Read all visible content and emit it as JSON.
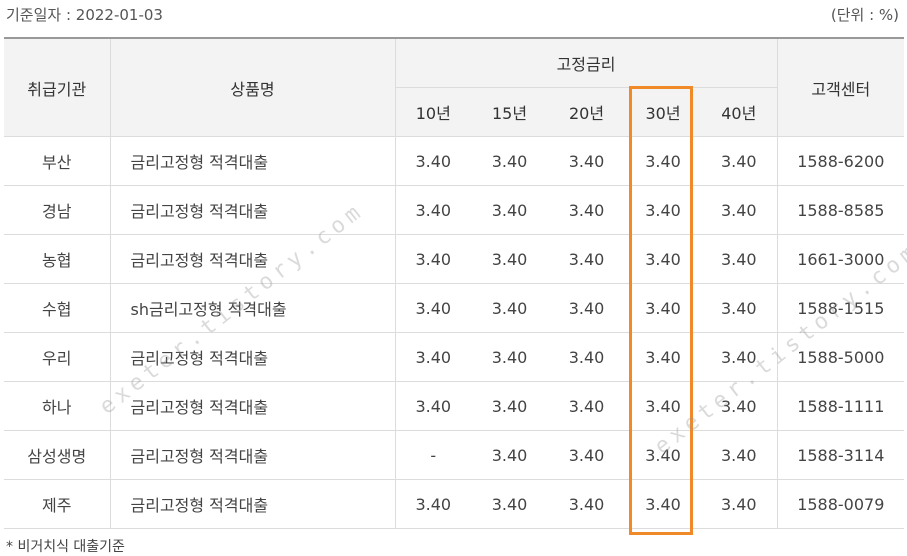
{
  "date_label": "기준일자 : 2022-01-03",
  "unit_label": "(단위 : %)",
  "headers": {
    "institution": "취급기관",
    "product": "상품명",
    "fixed_rate": "고정금리",
    "customer_center": "고객센터",
    "terms": [
      "10년",
      "15년",
      "20년",
      "30년",
      "40년"
    ]
  },
  "rows": [
    {
      "institution": "부산",
      "product": "금리고정형 적격대출",
      "rates": [
        "3.40",
        "3.40",
        "3.40",
        "3.40",
        "3.40"
      ],
      "phone": "1588-6200"
    },
    {
      "institution": "경남",
      "product": "금리고정형 적격대출",
      "rates": [
        "3.40",
        "3.40",
        "3.40",
        "3.40",
        "3.40"
      ],
      "phone": "1588-8585"
    },
    {
      "institution": "농협",
      "product": "금리고정형 적격대출",
      "rates": [
        "3.40",
        "3.40",
        "3.40",
        "3.40",
        "3.40"
      ],
      "phone": "1661-3000"
    },
    {
      "institution": "수협",
      "product": "sh금리고정형 적격대출",
      "rates": [
        "3.40",
        "3.40",
        "3.40",
        "3.40",
        "3.40"
      ],
      "phone": "1588-1515"
    },
    {
      "institution": "우리",
      "product": "금리고정형 적격대출",
      "rates": [
        "3.40",
        "3.40",
        "3.40",
        "3.40",
        "3.40"
      ],
      "phone": "1588-5000"
    },
    {
      "institution": "하나",
      "product": "금리고정형 적격대출",
      "rates": [
        "3.40",
        "3.40",
        "3.40",
        "3.40",
        "3.40"
      ],
      "phone": "1588-1111"
    },
    {
      "institution": "삼성생명",
      "product": "금리고정형 적격대출",
      "rates": [
        "-",
        "3.40",
        "3.40",
        "3.40",
        "3.40"
      ],
      "phone": "1588-3114"
    },
    {
      "institution": "제주",
      "product": "금리고정형 적격대출",
      "rates": [
        "3.40",
        "3.40",
        "3.40",
        "3.40",
        "3.40"
      ],
      "phone": "1588-0079"
    }
  ],
  "footnote": "* 비거치식 대출기준",
  "watermark": "exeter.tistory.com",
  "highlight_color": "#f08a28"
}
